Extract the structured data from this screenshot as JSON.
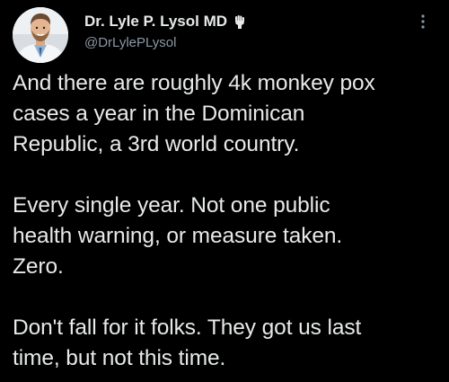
{
  "author": {
    "display_name": "Dr. Lyle P. Lysol MD",
    "handle": "@DrLylePLysol",
    "avatar_icon": "doctor-portrait-avatar",
    "badge_icon": "hand-raised-fist-icon"
  },
  "menu": {
    "more_icon": "vertical-ellipsis-icon"
  },
  "tweet": {
    "paragraphs": [
      {
        "lines": [
          "And there are roughly 4k monkey pox",
          "cases a year in the Dominican",
          "Republic, a 3rd world country."
        ]
      },
      {
        "lines": [
          "Every single year. Not one public",
          "health warning, or measure taken.",
          "Zero."
        ]
      },
      {
        "lines": [
          "Don't fall for it folks. They got us last",
          "time, but not this time."
        ]
      }
    ]
  },
  "colors": {
    "background": "#000000",
    "text_primary": "#e7e9ea",
    "text_secondary": "#8b98a5"
  }
}
